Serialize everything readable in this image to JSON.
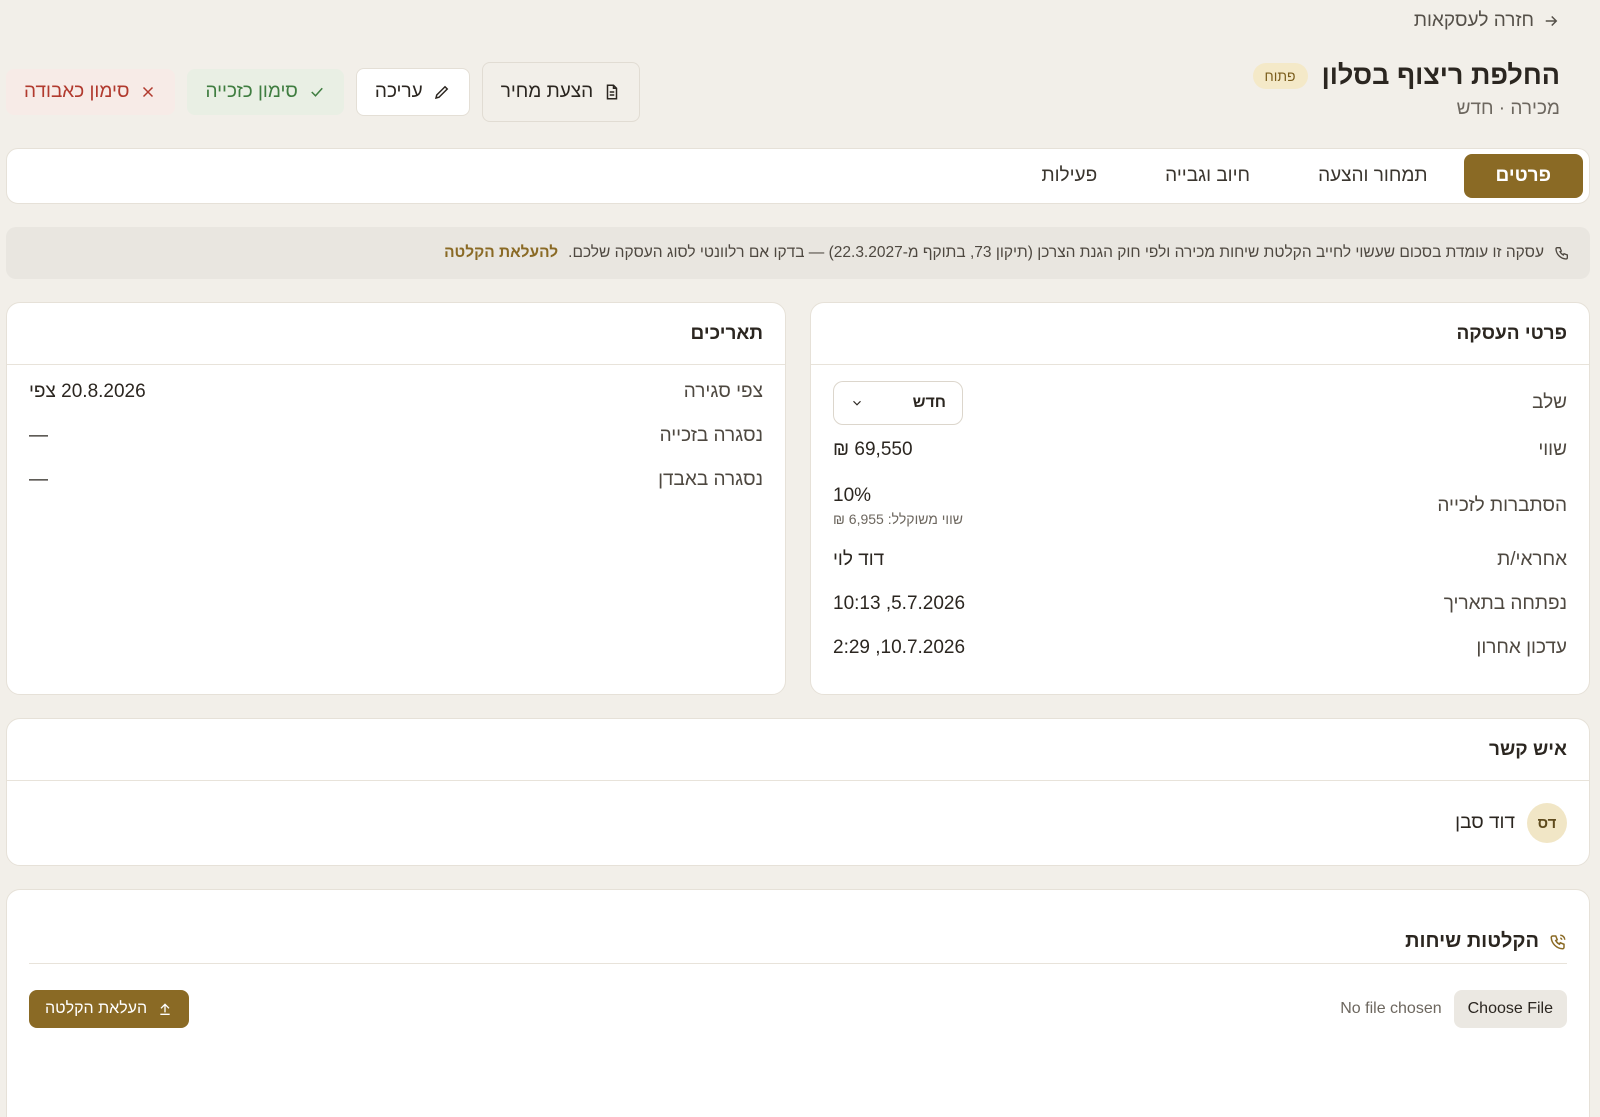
{
  "back_link": "חזרה לעסקאות",
  "header": {
    "title": "החלפת ריצוף בסלון",
    "status": "פתוח",
    "subtitle": "מכירה · חדש"
  },
  "actions": {
    "quote": "הצעת מחיר",
    "edit": "עריכה",
    "mark_win": "סימון כזכייה",
    "mark_loss": "סימון כאבודה"
  },
  "tabs": [
    {
      "label": "פרטים",
      "active": true
    },
    {
      "label": "תמחור והצעה",
      "active": false
    },
    {
      "label": "חיוב וגבייה",
      "active": false
    },
    {
      "label": "פעילות",
      "active": false
    }
  ],
  "notice": {
    "text": "עסקה זו עומדת בסכום שעשוי לחייב הקלטת שיחות מכירה ולפי חוק הגנת הצרכן (תיקון 73, בתוקף מ-22.3.2027) — בדקו אם רלוונטי לסוג העסקה שלכם.",
    "link": "להעלאת הקלטה"
  },
  "deal": {
    "title": "פרטי העסקה",
    "stage_label": "שלב",
    "stage_value": "חדש",
    "value_label": "שווי",
    "value": "₪ 69,550",
    "probability_label": "הסתברות לזכייה",
    "probability": "10%",
    "weighted": "שווי משוקלל: 6,955 ₪",
    "owner_label": "אחראי/ת",
    "owner": "דוד לוי",
    "opened_label": "נפתחה בתאריך",
    "opened": "10:13 ,5.7.2026",
    "updated_label": "עדכון אחרון",
    "updated": "2:29 ,10.7.2026"
  },
  "dates": {
    "title": "תאריכים",
    "expected_label": "צפי סגירה",
    "expected": "20.8.2026 צפי",
    "won_label": "נסגרה בזכייה",
    "won": "—",
    "lost_label": "נסגרה באבדן",
    "lost": "—"
  },
  "contact": {
    "title": "איש קשר",
    "initials": "דס",
    "name": "דוד סבן"
  },
  "recordings": {
    "title": "הקלטות שיחות",
    "choose_file": "Choose File",
    "no_file": "No file chosen",
    "upload": "העלאת הקלטה"
  },
  "colors": {
    "accent": "#8a6a25",
    "background": "#f2efe9",
    "win": "#3f7d40",
    "loss": "#b13a2e"
  }
}
